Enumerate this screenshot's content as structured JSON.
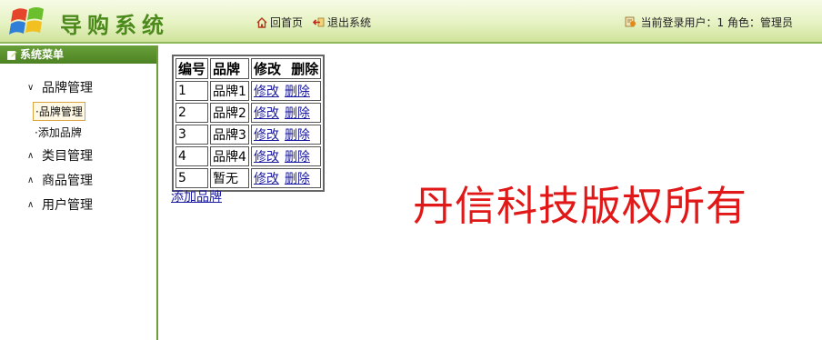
{
  "header": {
    "title": "导购系统",
    "home_label": "回首页",
    "logout_label": "退出系统",
    "user_info": "当前登录用户：1 角色：管理员"
  },
  "sidebar": {
    "title": "系统菜单",
    "groups": [
      {
        "label": "品牌管理",
        "expanded": true,
        "items": [
          {
            "label": "·品牌管理",
            "active": true
          },
          {
            "label": "·添加品牌",
            "active": false
          }
        ]
      },
      {
        "label": "类目管理",
        "expanded": false
      },
      {
        "label": "商品管理",
        "expanded": false
      },
      {
        "label": "用户管理",
        "expanded": false
      }
    ]
  },
  "table": {
    "headers": [
      "编号",
      "品牌",
      "修改",
      "删除"
    ],
    "rows": [
      {
        "id": "1",
        "brand": "品牌1",
        "edit": "修改",
        "delete": "删除"
      },
      {
        "id": "2",
        "brand": "品牌2",
        "edit": "修改",
        "delete": "删除"
      },
      {
        "id": "3",
        "brand": "品牌3",
        "edit": "修改",
        "delete": "删除"
      },
      {
        "id": "4",
        "brand": "品牌4",
        "edit": "修改",
        "delete": "删除"
      },
      {
        "id": "5",
        "brand": "暂无",
        "edit": "修改",
        "delete": "删除"
      }
    ]
  },
  "add_brand_label": "添加品牌",
  "copyright": "丹信科技版权所有",
  "colors": {
    "accent_green": "#4c8a1c",
    "link": "#1a1aa0",
    "copyright_red": "#e01818"
  }
}
